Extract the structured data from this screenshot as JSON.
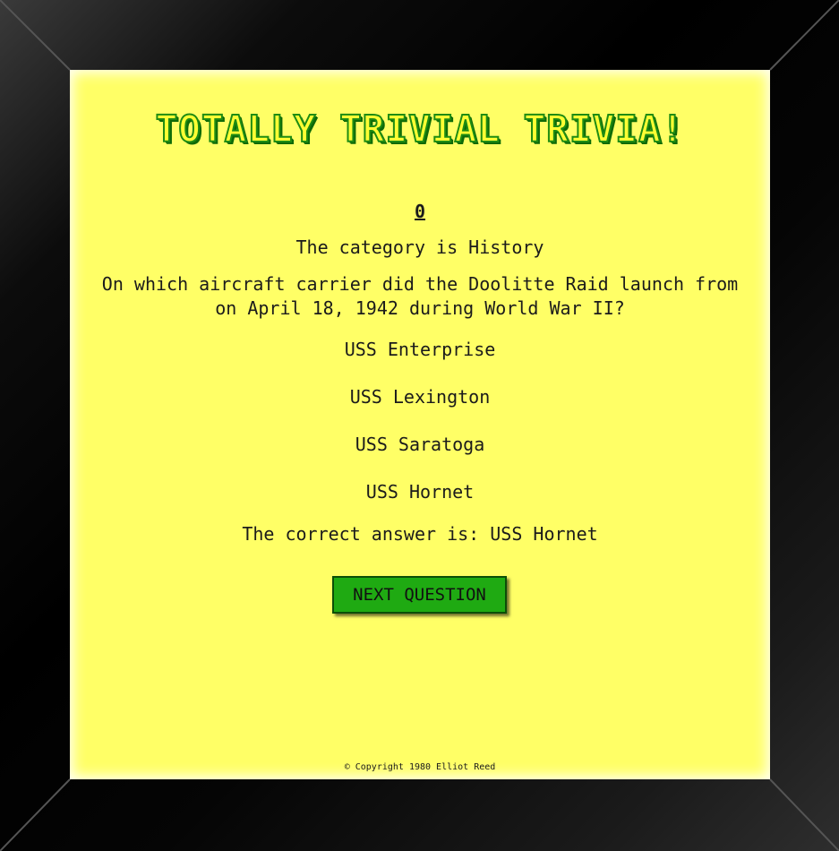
{
  "game": {
    "title": "TOTALLY TRIVIAL TRIVIA!",
    "score": "0",
    "category_text": "The category is History",
    "question": "On which aircraft carrier did the Doolitte Raid launch from on April 18, 1942 during World War II?",
    "answers": [
      "USS Enterprise",
      "USS Lexington",
      "USS Saratoga",
      "USS Hornet"
    ],
    "result_text": "The correct answer is: USS Hornet",
    "next_button": "NEXT QUESTION",
    "footer": "© Copyright 1980 Elliot Reed"
  },
  "colors": {
    "screen_bg": "#ffff66",
    "title_fill": "#ffff33",
    "title_outline": "#1f8c13",
    "button_bg": "#1faa12",
    "frame": "#000000"
  }
}
